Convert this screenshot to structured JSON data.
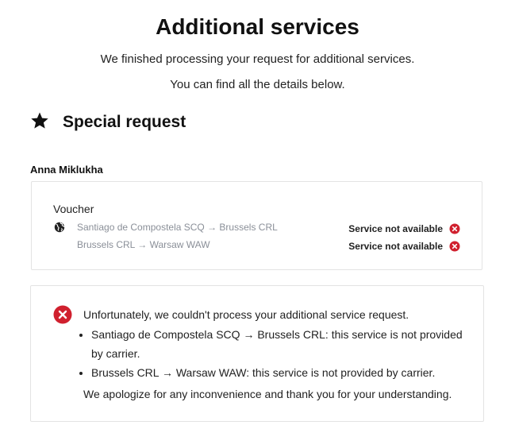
{
  "header": {
    "title": "Additional services",
    "subtitle_line1": "We finished processing your request for additional services.",
    "subtitle_line2": "You can find all the details below."
  },
  "section": {
    "icon": "star-icon",
    "title": "Special request"
  },
  "passenger": {
    "name": "Anna Miklukha"
  },
  "service_card": {
    "service_name": "Voucher",
    "icon": "globe-icon",
    "rows": [
      {
        "route": "Santiago de Compostela SCQ → Brussels CRL",
        "status": "Service not available"
      },
      {
        "route": "Brussels CRL → Warsaw WAW",
        "status": "Service not available"
      }
    ]
  },
  "error_notice": {
    "icon": "error-circle-icon",
    "intro": "Unfortunately, we couldn't process your additional service request.",
    "items": [
      "Santiago de Compostela SCQ → Brussels CRL: this service is not provided by carrier.",
      "Brussels CRL → Warsaw WAW: this service is not provided by carrier."
    ],
    "outro": "We apologize for any inconvenience and thank you for your understanding."
  },
  "colors": {
    "error_red": "#d0202e",
    "muted_text": "#8a8f98",
    "border": "#e3e3e3"
  }
}
